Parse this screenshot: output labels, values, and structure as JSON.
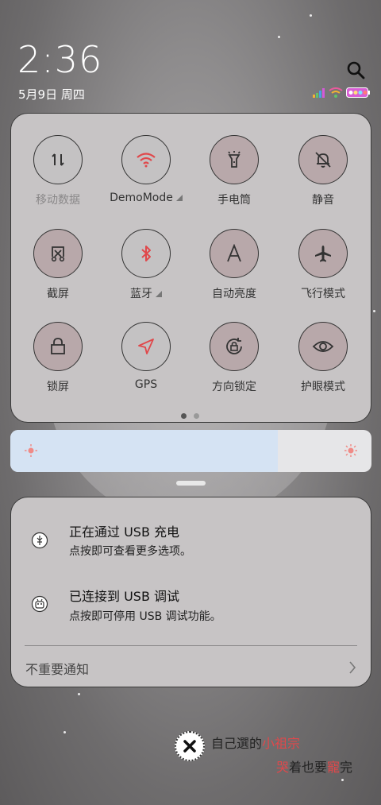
{
  "status_bar": {
    "time": "2:36",
    "date": "5月9日 周四"
  },
  "quick_settings": {
    "tiles": [
      {
        "label": "移动数据",
        "icon": "mobile-data-icon",
        "state": "off"
      },
      {
        "label": "DemoMode",
        "icon": "wifi-icon",
        "state": "on",
        "has_arrow": true
      },
      {
        "label": "手电筒",
        "icon": "flashlight-icon",
        "state": "on"
      },
      {
        "label": "静音",
        "icon": "mute-bell-icon",
        "state": "on"
      },
      {
        "label": "截屏",
        "icon": "screenshot-icon",
        "state": "on"
      },
      {
        "label": "蓝牙",
        "icon": "bluetooth-icon",
        "state": "on",
        "has_arrow": true
      },
      {
        "label": "自动亮度",
        "icon": "auto-brightness-icon",
        "state": "on"
      },
      {
        "label": "飞行模式",
        "icon": "airplane-icon",
        "state": "on"
      },
      {
        "label": "锁屏",
        "icon": "lock-icon",
        "state": "on"
      },
      {
        "label": "GPS",
        "icon": "gps-icon",
        "state": "off"
      },
      {
        "label": "方向锁定",
        "icon": "rotation-lock-icon",
        "state": "on"
      },
      {
        "label": "护眼模式",
        "icon": "eye-icon",
        "state": "on"
      }
    ],
    "page_count": 2,
    "current_page": 1
  },
  "brightness": {
    "level": 0.74
  },
  "notifications": [
    {
      "title": "正在通过 USB 充电",
      "text": "点按即可查看更多选项。",
      "icon": "usb-icon"
    },
    {
      "title": "已连接到 USB 调试",
      "text": "点按即可停用 USB 调试功能。",
      "icon": "android-debug-icon"
    }
  ],
  "minor_notifications_label": "不重要通知",
  "credits": {
    "line1_plain": "自己選的",
    "line1_accent": "小祖宗",
    "line2_accent": "哭",
    "line2_plain": "着也要",
    "line2_accent2": "寵",
    "line2_end": "完"
  },
  "colors": {
    "accent_red": "#e0484b",
    "tile_active_bg": "#b8a8aa",
    "panel_bg": "#c7c4c5"
  }
}
